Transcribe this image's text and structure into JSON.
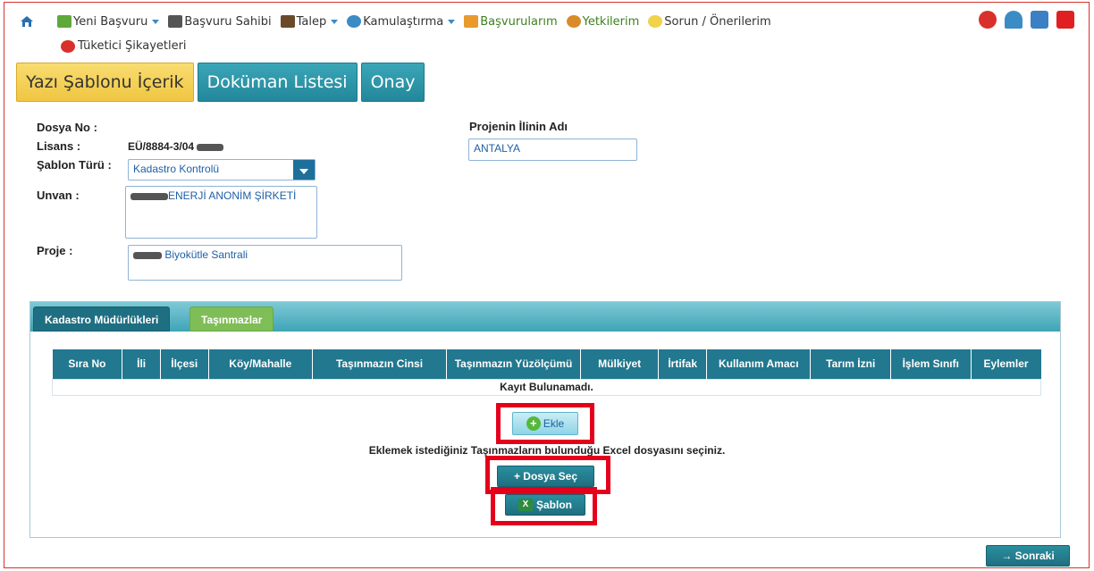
{
  "nav": {
    "items": [
      {
        "label": "Yeni Başvuru",
        "dropdown": true,
        "icon": "new-application-icon"
      },
      {
        "label": "Başvuru Sahibi",
        "dropdown": false,
        "icon": "applicant-icon"
      },
      {
        "label": "Talep",
        "dropdown": true,
        "icon": "request-icon"
      },
      {
        "label": "Kamulaştırma",
        "dropdown": true,
        "icon": "globe-icon"
      },
      {
        "label": "Başvurularım",
        "dropdown": false,
        "icon": "my-applications-icon"
      },
      {
        "label": "Yetkilerim",
        "dropdown": false,
        "icon": "permissions-icon"
      },
      {
        "label": "Sorun / Önerilerim",
        "dropdown": false,
        "icon": "feedback-icon"
      }
    ],
    "second_row": "Tüketici Şikayetleri"
  },
  "page_tabs": [
    "Yazı Şablonu İçerik",
    "Doküman Listesi",
    "Onay"
  ],
  "form": {
    "dosya_no_label": "Dosya No :",
    "lisans_label": "Lisans :",
    "lisans_value": "EÜ/8884-3/04",
    "sablon_turu_label": "Şablon Türü :",
    "sablon_turu_value": "Kadastro Kontrolü",
    "unvan_label": "Unvan :",
    "unvan_value": "ENERJİ ANONİM ŞİRKETİ",
    "proje_label": "Proje :",
    "proje_value": "Biyokütle Santrali",
    "il_label": "Projenin İlinin Adı",
    "il_value": "ANTALYA"
  },
  "section_tabs": [
    "Kadastro Müdürlükleri",
    "Taşınmazlar"
  ],
  "table": {
    "headers": [
      "Sıra No",
      "İli",
      "İlçesi",
      "Köy/Mahalle",
      "Taşınmazın Cinsi",
      "Taşınmazın Yüzölçümü",
      "Mülkiyet",
      "İrtifak",
      "Kullanım Amacı",
      "Tarım İzni",
      "İşlem Sınıfı",
      "Eylemler"
    ],
    "empty_text": "Kayıt Bulunamadı."
  },
  "actions": {
    "ekle": "Ekle",
    "excel_prompt": "Eklemek istediğiniz Taşınmazların bulunduğu Excel dosyasını seçiniz.",
    "dosya_sec": "+ Dosya Seç",
    "sablon": "Şablon",
    "sonraki": "→ Sonraki"
  },
  "colors": {
    "highlight": "#e4001b",
    "teal": "#21788f",
    "active_tab": "#f0c642"
  }
}
